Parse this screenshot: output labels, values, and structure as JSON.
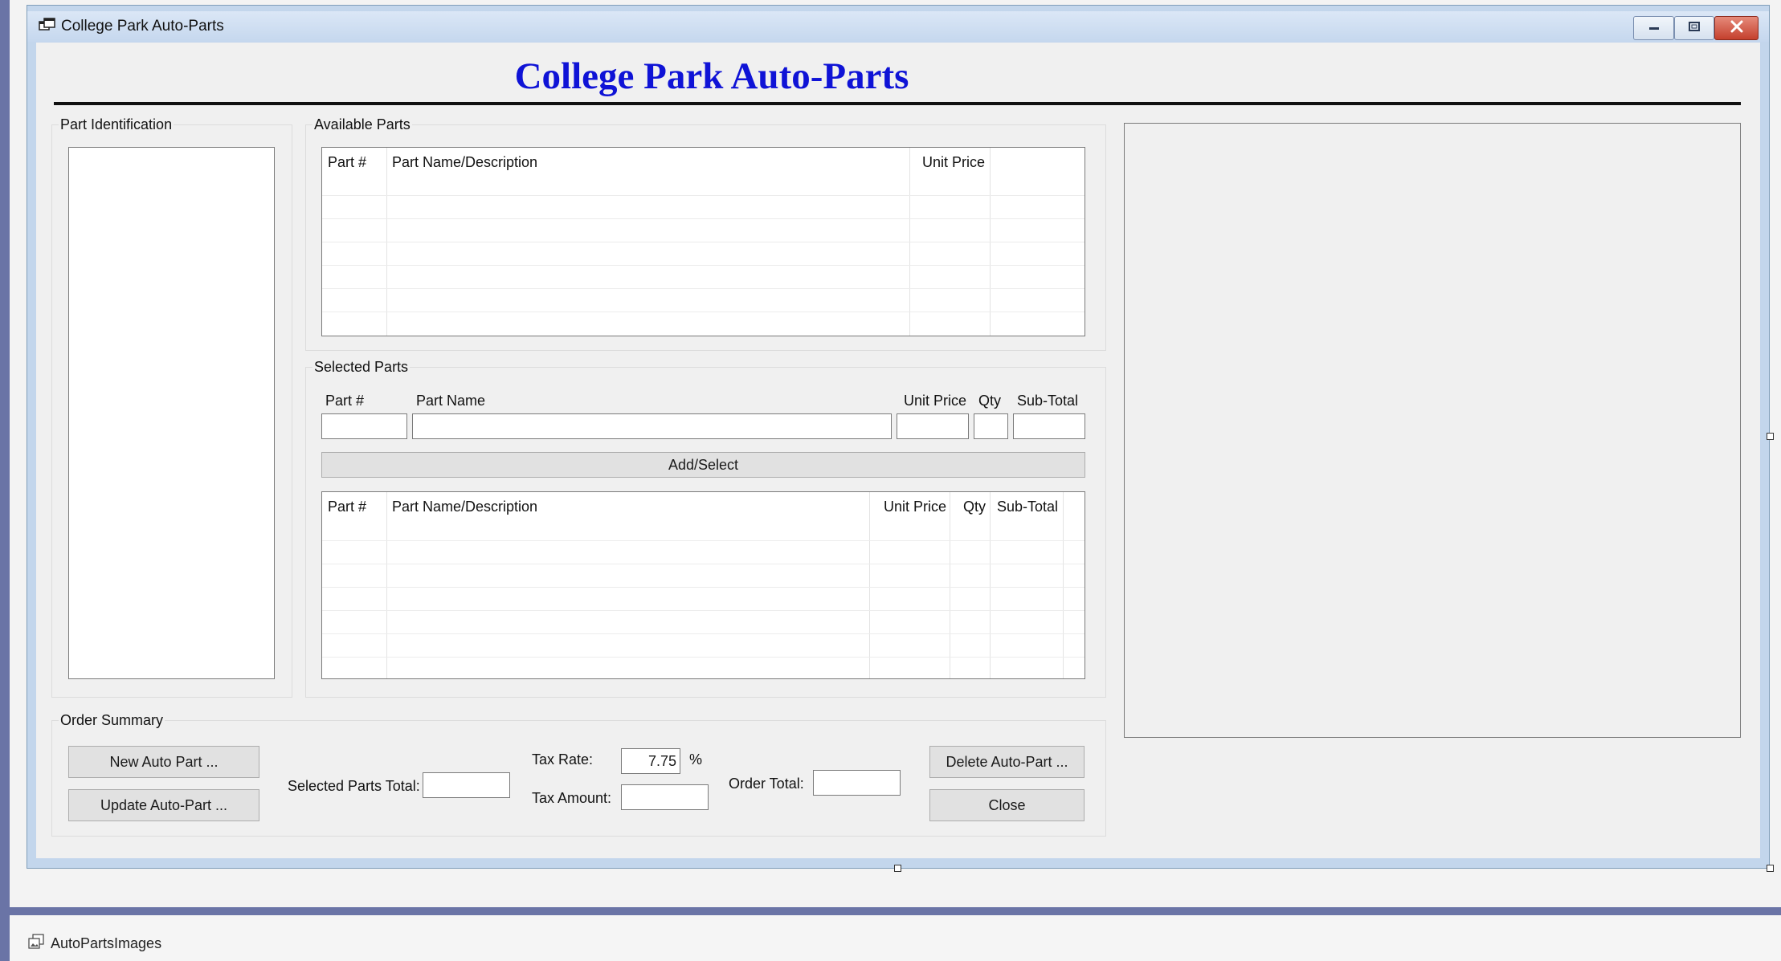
{
  "window": {
    "title": "College Park Auto-Parts",
    "icon": "form-icon",
    "controls": [
      "minimize-icon",
      "maximize-icon",
      "close-icon"
    ]
  },
  "form": {
    "heading": "College Park Auto-Parts",
    "heading_color": "#0f13d6"
  },
  "part_identification": {
    "label": "Part Identification"
  },
  "available_parts": {
    "label": "Available Parts",
    "columns": [
      "Part #",
      "Part Name/Description",
      "Unit Price"
    ],
    "rows": []
  },
  "selected_parts": {
    "label": "Selected Parts",
    "entry_labels": {
      "part_number": "Part #",
      "part_name": "Part Name",
      "unit_price": "Unit Price",
      "qty": "Qty",
      "sub_total": "Sub-Total"
    },
    "entry_values": {
      "part_number": "",
      "part_name": "",
      "unit_price": "",
      "qty": "",
      "sub_total": ""
    },
    "add_button": "Add/Select",
    "columns": [
      "Part #",
      "Part Name/Description",
      "Unit Price",
      "Qty",
      "Sub-Total"
    ],
    "rows": []
  },
  "order_summary": {
    "label": "Order Summary",
    "new_button": "New Auto Part ...",
    "update_button": "Update Auto-Part ...",
    "selected_total_label": "Selected Parts Total:",
    "selected_total_value": "",
    "tax_rate_label": "Tax Rate:",
    "tax_rate_value": "7.75",
    "tax_rate_unit": "%",
    "tax_amount_label": "Tax Amount:",
    "tax_amount_value": "",
    "order_total_label": "Order Total:",
    "order_total_value": "",
    "delete_button": "Delete Auto-Part ...",
    "close_button": "Close"
  },
  "component_tray": {
    "icon": "image-list-icon",
    "item": "AutoPartsImages"
  }
}
